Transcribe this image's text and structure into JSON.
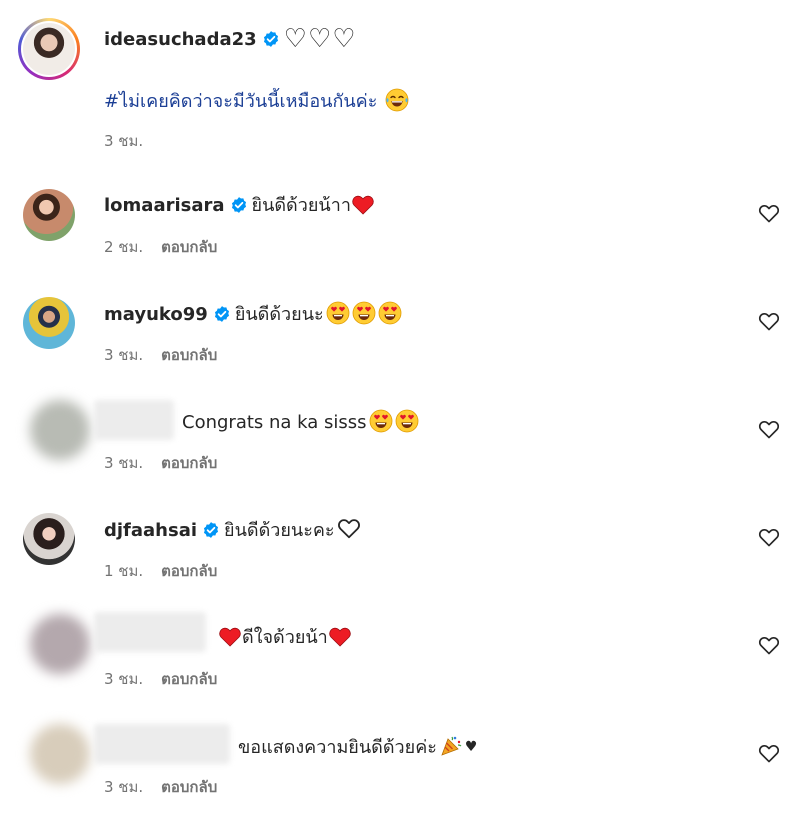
{
  "caption": {
    "username": "ideasuchada23",
    "hearts": "♡♡♡",
    "hashtag": "#ไม่เคยคิดว่าจะมีวันนี้เหมือนกันค่ะ",
    "time": "3 ชม."
  },
  "reply_label": "ตอบกลับ",
  "comments": [
    {
      "username": "lomaarisara",
      "text": "ยินดีด้วยน้าา",
      "time": "2 ชม."
    },
    {
      "username": "mayuko99",
      "text": "ยินดีด้วยนะ",
      "time": "3 ชม."
    },
    {
      "username": "",
      "text": "Congrats na ka sisss",
      "time": "3 ชม."
    },
    {
      "username": "djfaahsai",
      "text": "ยินดีด้วยนะคะ",
      "time": "1 ชม."
    },
    {
      "username": "",
      "text": "ดีใจด้วยน้า",
      "time": "3 ชม."
    },
    {
      "username": "",
      "text": "ขอแสดงความยินดีด้วยค่ะ",
      "time": "3 ชม."
    }
  ],
  "colors": {
    "verified": "#0095f6",
    "heart_red": "#ed1c24",
    "hashtag": "#1c3f95",
    "meta": "#737373"
  },
  "icons": {
    "verified": "verified-badge-icon",
    "like": "heart-outline-icon",
    "laugh": "tears-of-joy-emoji-icon",
    "love": "heart-eyes-emoji-icon",
    "party": "party-popper-emoji-icon"
  }
}
